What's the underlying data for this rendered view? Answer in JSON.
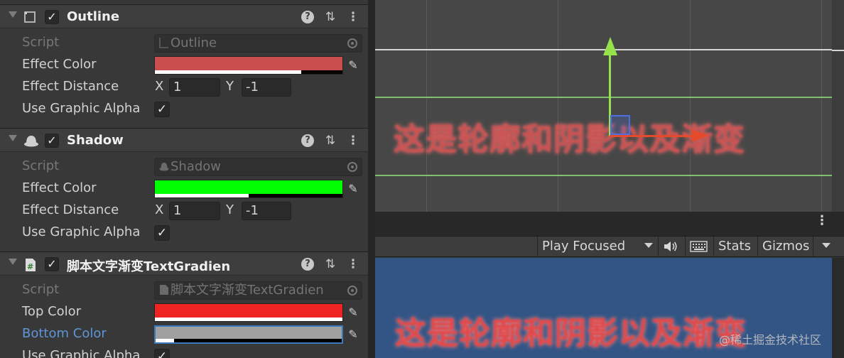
{
  "inspector": {
    "outline": {
      "title": "Outline",
      "script_label": "Script",
      "script_value": "Outline",
      "effect_color_label": "Effect Color",
      "effect_color": "#c94f4f",
      "effect_color_alpha": 0.78,
      "effect_distance_label": "Effect Distance",
      "x_label": "X",
      "x_value": "1",
      "y_label": "Y",
      "y_value": "-1",
      "use_graphic_alpha_label": "Use Graphic Alpha",
      "use_graphic_alpha": "✓",
      "enabled": "✓"
    },
    "shadow": {
      "title": "Shadow",
      "script_label": "Script",
      "script_value": "Shadow",
      "effect_color_label": "Effect Color",
      "effect_color": "#00ff00",
      "effect_color_alpha": 0.5,
      "effect_distance_label": "Effect Distance",
      "x_label": "X",
      "x_value": "1",
      "y_label": "Y",
      "y_value": "-1",
      "use_graphic_alpha_label": "Use Graphic Alpha",
      "use_graphic_alpha": "✓",
      "enabled": "✓"
    },
    "gradient": {
      "title": "脚本文字渐变TextGradien",
      "script_label": "Script",
      "script_value": "脚本文字渐变TextGradien",
      "top_color_label": "Top Color",
      "top_color": "#f02323",
      "top_color_alpha": 1.0,
      "bottom_color_label": "Bottom Color",
      "bottom_color": "#a0a0a0",
      "bottom_color_alpha": 0.1,
      "use_graphic_alpha_label": "Use Graphic Alpha",
      "use_graphic_alpha": "✓",
      "enabled": "✓"
    },
    "icons": {
      "help": "?",
      "presets": "⇅",
      "menu": "⋮",
      "eyedropper": "✎"
    }
  },
  "scene": {
    "text": "这是轮廓和阴影以及渐变"
  },
  "game_toolbar": {
    "menu": "⋮",
    "play_mode": "Play Focused",
    "audio_icon": "speaker-icon",
    "stats": "Stats",
    "gizmos": "Gizmos"
  },
  "game_view": {
    "text": "这是轮廓和阴影以及渐变",
    "watermark": "@稀土掘金技术社区"
  }
}
